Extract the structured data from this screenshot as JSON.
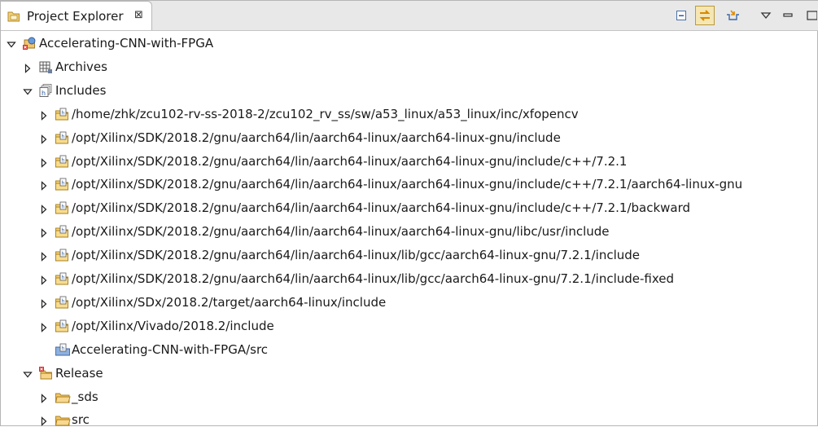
{
  "view": {
    "tab_title": "Project Explorer",
    "tab_close_glyph": "⊠",
    "toolbar_buttons": [
      {
        "name": "collapse-all-icon",
        "active": false
      },
      {
        "name": "link-with-editor-icon",
        "active": true
      },
      {
        "name": "focus-icon",
        "active": false
      },
      {
        "name": "view-menu-icon",
        "active": false
      },
      {
        "name": "minimize-icon",
        "active": false
      },
      {
        "name": "maximize-icon",
        "active": false
      }
    ]
  },
  "tree": [
    {
      "label": "Accelerating-CNN-with-FPGA",
      "level": 0,
      "state": "expanded",
      "icon": "project-error-icon"
    },
    {
      "label": "Archives",
      "level": 1,
      "state": "collapsed",
      "icon": "archives-icon"
    },
    {
      "label": "Includes",
      "level": 1,
      "state": "expanded",
      "icon": "includes-icon"
    },
    {
      "label": "/home/zhk/zcu102-rv-ss-2018-2/zcu102_rv_ss/sw/a53_linux/a53_linux/inc/xfopencv",
      "level": 2,
      "state": "collapsed",
      "icon": "include-folder-icon"
    },
    {
      "label": "/opt/Xilinx/SDK/2018.2/gnu/aarch64/lin/aarch64-linux/aarch64-linux-gnu/include",
      "level": 2,
      "state": "collapsed",
      "icon": "include-folder-icon"
    },
    {
      "label": "/opt/Xilinx/SDK/2018.2/gnu/aarch64/lin/aarch64-linux/aarch64-linux-gnu/include/c++/7.2.1",
      "level": 2,
      "state": "collapsed",
      "icon": "include-folder-icon"
    },
    {
      "label": "/opt/Xilinx/SDK/2018.2/gnu/aarch64/lin/aarch64-linux/aarch64-linux-gnu/include/c++/7.2.1/aarch64-linux-gnu",
      "level": 2,
      "state": "collapsed",
      "icon": "include-folder-icon"
    },
    {
      "label": "/opt/Xilinx/SDK/2018.2/gnu/aarch64/lin/aarch64-linux/aarch64-linux-gnu/include/c++/7.2.1/backward",
      "level": 2,
      "state": "collapsed",
      "icon": "include-folder-icon"
    },
    {
      "label": "/opt/Xilinx/SDK/2018.2/gnu/aarch64/lin/aarch64-linux/aarch64-linux-gnu/libc/usr/include",
      "level": 2,
      "state": "collapsed",
      "icon": "include-folder-icon"
    },
    {
      "label": "/opt/Xilinx/SDK/2018.2/gnu/aarch64/lin/aarch64-linux/lib/gcc/aarch64-linux-gnu/7.2.1/include",
      "level": 2,
      "state": "collapsed",
      "icon": "include-folder-icon"
    },
    {
      "label": "/opt/Xilinx/SDK/2018.2/gnu/aarch64/lin/aarch64-linux/lib/gcc/aarch64-linux-gnu/7.2.1/include-fixed",
      "level": 2,
      "state": "collapsed",
      "icon": "include-folder-icon"
    },
    {
      "label": "/opt/Xilinx/SDx/2018.2/target/aarch64-linux/include",
      "level": 2,
      "state": "collapsed",
      "icon": "include-folder-icon"
    },
    {
      "label": "/opt/Xilinx/Vivado/2018.2/include",
      "level": 2,
      "state": "collapsed",
      "icon": "include-folder-icon"
    },
    {
      "label": "Accelerating-CNN-with-FPGA/src",
      "level": 2,
      "state": "leaf",
      "icon": "include-source-icon"
    },
    {
      "label": "Release",
      "level": 1,
      "state": "expanded",
      "icon": "release-folder-error-icon"
    },
    {
      "label": "_sds",
      "level": 2,
      "state": "collapsed",
      "icon": "folder-icon"
    },
    {
      "label": "src",
      "level": 2,
      "state": "collapsed",
      "icon": "folder-icon"
    }
  ]
}
